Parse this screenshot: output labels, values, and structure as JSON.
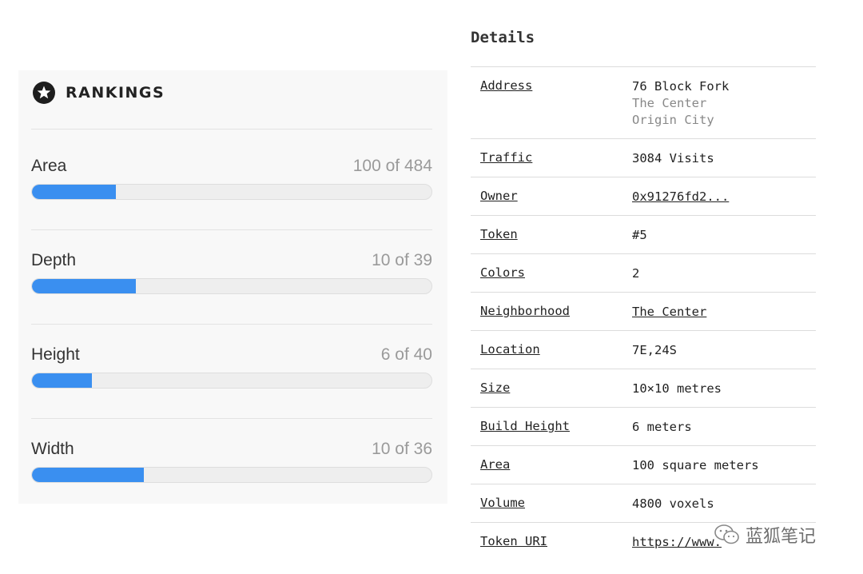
{
  "rankings": {
    "title": "RANKINGS",
    "icon": "star-circle-icon",
    "accent_color": "#3a8ff0",
    "items": [
      {
        "label": "Area",
        "value": "100 of 484",
        "fill_fraction": 0.21
      },
      {
        "label": "Depth",
        "value": "10 of 39",
        "fill_fraction": 0.26
      },
      {
        "label": "Height",
        "value": "6 of 40",
        "fill_fraction": 0.15
      },
      {
        "label": "Width",
        "value": "10 of 36",
        "fill_fraction": 0.28
      }
    ]
  },
  "details": {
    "title": "Details",
    "rows": [
      {
        "key": "Address",
        "value": "76 Block Fork",
        "sub": [
          "The Center",
          "Origin City"
        ]
      },
      {
        "key": "Traffic",
        "value": "3084 Visits"
      },
      {
        "key": "Owner",
        "value": "0x91276fd2...",
        "link": true
      },
      {
        "key": "Token",
        "value": "#5"
      },
      {
        "key": "Colors",
        "value": "2"
      },
      {
        "key": "Neighborhood",
        "value": "The Center",
        "link": true
      },
      {
        "key": "Location",
        "value": "7E,24S"
      },
      {
        "key": "Size",
        "value": "10×10 metres"
      },
      {
        "key": "Build Height",
        "value": "6 meters"
      },
      {
        "key": "Area",
        "value": "100 square meters"
      },
      {
        "key": "Volume",
        "value": "4800 voxels"
      },
      {
        "key": "Token URI",
        "value": "https://www.",
        "link": true
      }
    ]
  },
  "watermark": {
    "text": "蓝狐笔记",
    "icon": "wechat-icon"
  }
}
